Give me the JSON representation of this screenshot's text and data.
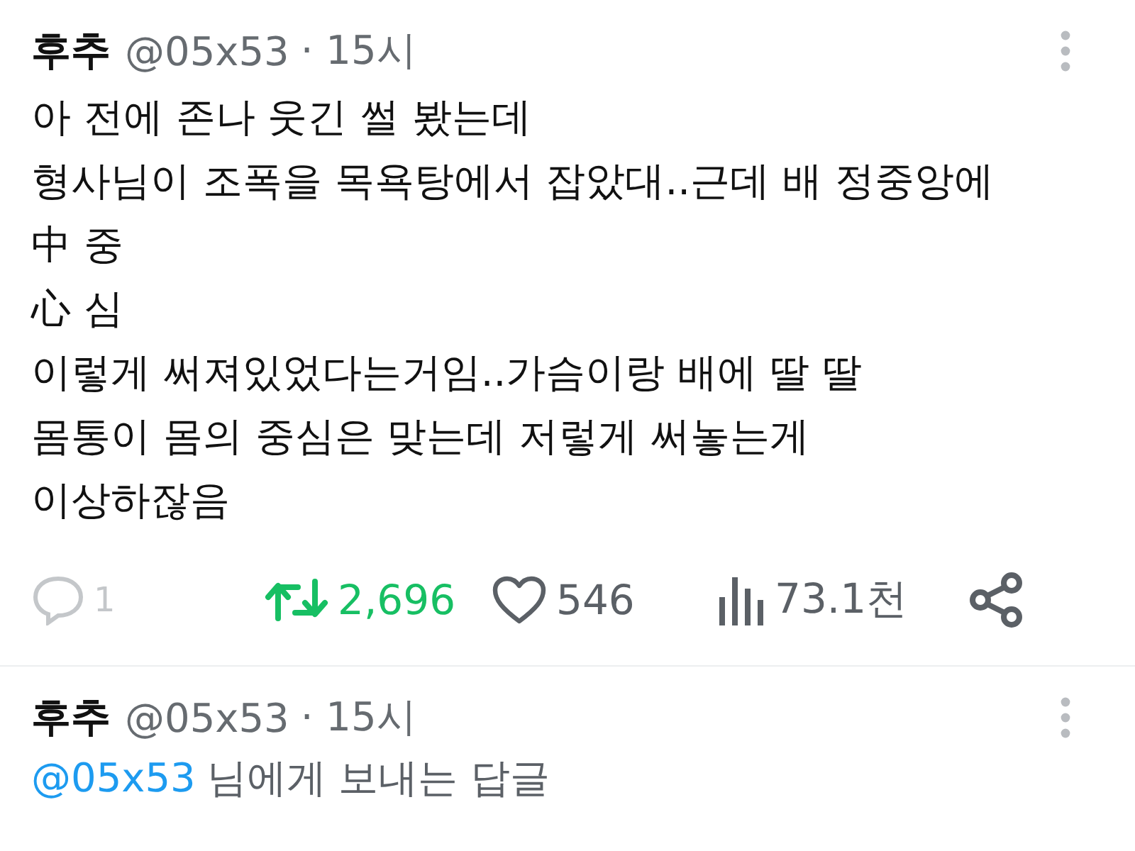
{
  "tweets": [
    {
      "name": "후추",
      "handle": "@05x53",
      "time": "· 15시",
      "body": [
        "아 전에 존나 웃긴 썰 봤는데",
        "형사님이 조폭을 목욕탕에서 잡았대..근데 배 정중앙에",
        "中 중",
        "心 심",
        "이렇게 써져있었다는거임..가슴이랑 배에 딸 딸",
        "몸통이 몸의 중심은 맞는데 저렇게 써놓는게",
        "이상하잖음"
      ],
      "actions": [
        {
          "kind": "reply",
          "count": "1",
          "active": false
        },
        {
          "kind": "retweet",
          "count": "2,696",
          "active": true
        },
        {
          "kind": "like",
          "count": "546",
          "active": false
        },
        {
          "kind": "views",
          "count": "73.1천",
          "active": false
        },
        {
          "kind": "share",
          "active": false
        }
      ]
    },
    {
      "name": "후추",
      "handle": "@05x53",
      "time": "· 15시",
      "replying_to": {
        "mention": "@05x53",
        "text": "님에게 보내는 답글"
      }
    }
  ]
}
